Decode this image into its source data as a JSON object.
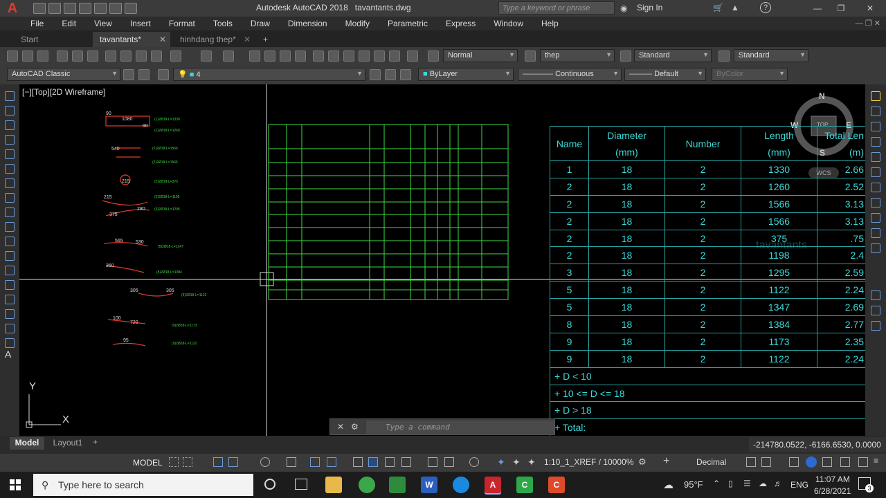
{
  "titlebar": {
    "app_title": "Autodesk AutoCAD 2018",
    "file_name": "tavantants.dwg",
    "search_placeholder": "Type a keyword or phrase",
    "sign_in": "Sign In"
  },
  "menu": [
    "File",
    "Edit",
    "View",
    "Insert",
    "Format",
    "Tools",
    "Draw",
    "Dimension",
    "Modify",
    "Parametric",
    "Express",
    "Window",
    "Help"
  ],
  "tabs": [
    "Start",
    "tavantants*",
    "hinhdang thep*"
  ],
  "toolbar1": {
    "text_style": "Normal",
    "dim_style": "thep",
    "table_style": "Standard",
    "mleader_style": "Standard"
  },
  "toolbar2": {
    "workspace": "AutoCAD Classic",
    "layer": "4",
    "color": "ByLayer",
    "linetype": "Continuous",
    "lineweight": "Default",
    "plotstyle": "ByColor"
  },
  "viewport_label": "[−][Top][2D Wireframe]",
  "viewcube": {
    "n": "N",
    "s": "S",
    "e": "E",
    "w": "W",
    "top": "TOP",
    "wcs": "WCS"
  },
  "watermark": "tavantants",
  "ucs": {
    "x": "X",
    "y": "Y"
  },
  "steel_table": {
    "headers": [
      "Name",
      "Diameter",
      "Number",
      "Length",
      "Total Len"
    ],
    "units": [
      "",
      "(mm)",
      "",
      "(mm)",
      "(m)"
    ],
    "rows": [
      [
        "1",
        "18",
        "2",
        "1330",
        "2.66"
      ],
      [
        "2",
        "18",
        "2",
        "1260",
        "2.52"
      ],
      [
        "2",
        "18",
        "2",
        "1566",
        "3.13"
      ],
      [
        "2",
        "18",
        "2",
        "1566",
        "3.13"
      ],
      [
        "2",
        "18",
        "2",
        "375",
        ".75"
      ],
      [
        "2",
        "18",
        "2",
        "1198",
        "2.4"
      ],
      [
        "3",
        "18",
        "2",
        "1295",
        "2.59"
      ],
      [
        "5",
        "18",
        "2",
        "1122",
        "2.24"
      ],
      [
        "5",
        "18",
        "2",
        "1347",
        "2.69"
      ],
      [
        "8",
        "18",
        "2",
        "1384",
        "2.77"
      ],
      [
        "9",
        "18",
        "2",
        "1173",
        "2.35"
      ],
      [
        "9",
        "18",
        "2",
        "1122",
        "2.24"
      ]
    ],
    "summary": [
      "+ D < 10",
      "+ 10 <= D <= 18",
      "+ D > 18",
      "+ Total:"
    ]
  },
  "command_placeholder": "Type a command",
  "layout_tabs": [
    "Model",
    "Layout1"
  ],
  "coords": "-214780.0522, -6166.6530, 0.0000",
  "status": {
    "model": "MODEL",
    "annoscale": "1:10_1_XREF / 10000%",
    "units": "Decimal"
  },
  "taskbar": {
    "search_placeholder": "Type here to search",
    "weather": "95°F",
    "lang": "ENG",
    "time": "11:07 AM",
    "date": "6/28/2021",
    "notif": "3"
  }
}
